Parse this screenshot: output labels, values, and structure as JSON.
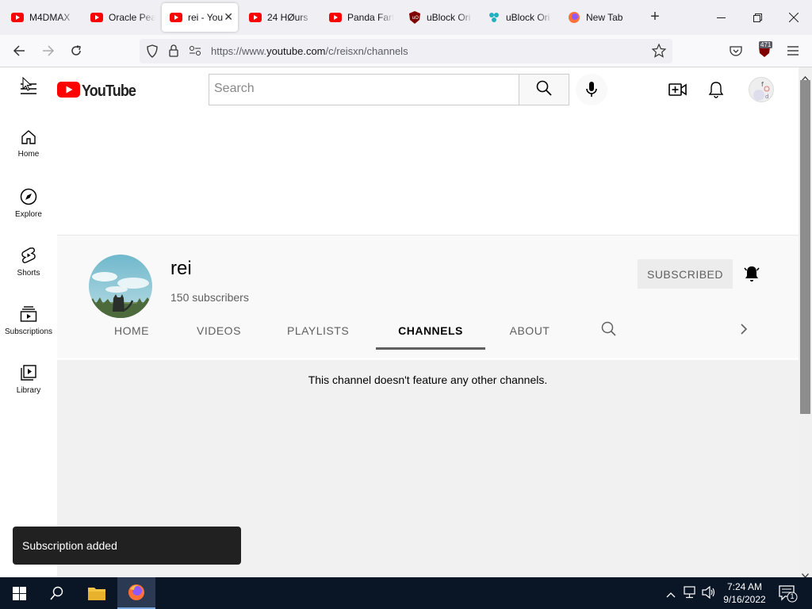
{
  "browser": {
    "tabs": [
      {
        "title": "M4DMAX",
        "icon": "youtube-favicon"
      },
      {
        "title": "Oracle Pea",
        "icon": "youtube-favicon"
      },
      {
        "title": "rei - You",
        "icon": "youtube-favicon",
        "active": true
      },
      {
        "title": "24 HØurs",
        "icon": "youtube-favicon"
      },
      {
        "title": "Panda Fart",
        "icon": "youtube-favicon"
      },
      {
        "title": "uBlock Ori",
        "icon": "ublock-favicon"
      },
      {
        "title": "uBlock Ori",
        "icon": "ublock-dashboard-favicon"
      },
      {
        "title": "New Tab",
        "icon": "firefox-favicon"
      }
    ],
    "url": {
      "prefix": "https://www.",
      "domain": "youtube.com",
      "path": "/c/reisxn/channels"
    },
    "ublock_badge": "471"
  },
  "youtube": {
    "logo_text": "YouTube",
    "search": {
      "placeholder": "Search"
    },
    "guide": [
      {
        "label": "Home",
        "icon": "home-icon"
      },
      {
        "label": "Explore",
        "icon": "compass-icon"
      },
      {
        "label": "Shorts",
        "icon": "shorts-icon"
      },
      {
        "label": "Subscriptions",
        "icon": "subscriptions-icon"
      },
      {
        "label": "Library",
        "icon": "library-icon"
      }
    ],
    "channel": {
      "name": "rei",
      "subscribers": "150 subscribers",
      "subscribe_label": "SUBSCRIBED"
    },
    "tabs": [
      "HOME",
      "VIDEOS",
      "PLAYLISTS",
      "CHANNELS",
      "ABOUT"
    ],
    "active_tab": "CHANNELS",
    "empty_message": "This channel doesn't feature any other channels.",
    "toast": "Subscription added"
  },
  "taskbar": {
    "time": "7:24 AM",
    "date": "9/16/2022",
    "notification_count": "1"
  },
  "colors": {
    "youtube_red": "#ff0000",
    "taskbar": "#0a1526"
  }
}
